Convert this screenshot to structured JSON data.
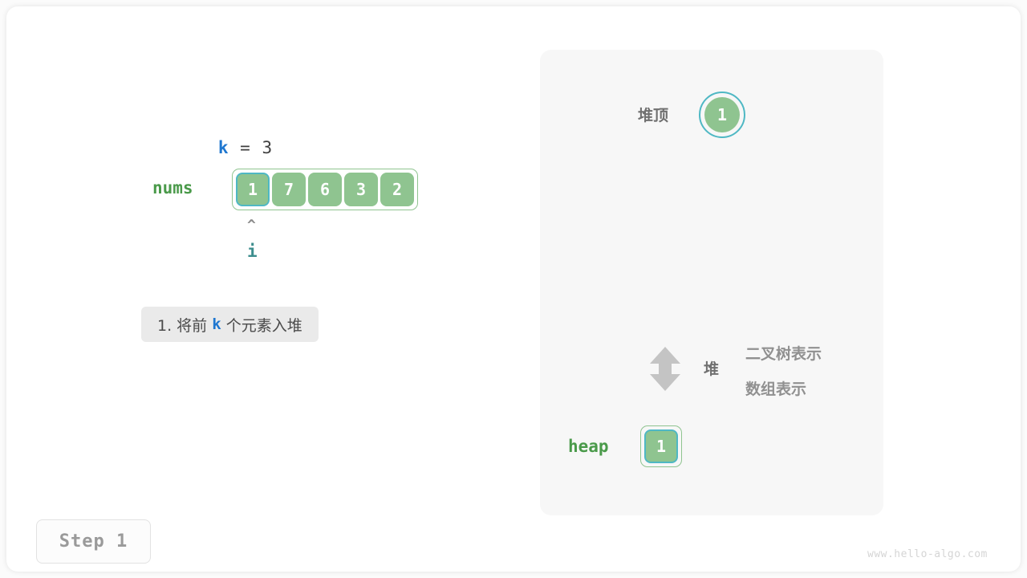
{
  "left": {
    "k_label": "k",
    "k_rest": " = 3",
    "nums_label": "nums",
    "nums_values": [
      "1",
      "7",
      "6",
      "3",
      "2"
    ],
    "nums_highlight_index": 0,
    "pointer_caret": "^",
    "pointer_name": "i",
    "caption_prefix": "1. 将前 ",
    "caption_keyword": "k",
    "caption_suffix": " 个元素入堆"
  },
  "right": {
    "heap_top_label": "堆顶",
    "heap_top_value": "1",
    "relation_label": "堆",
    "repr_binary_tree": "二叉树表示",
    "repr_array": "数组表示",
    "heap_label": "heap",
    "heap_values": [
      "1"
    ],
    "heap_highlight_index": 0
  },
  "footer": {
    "step_label": "Step 1",
    "watermark": "www.hello-algo.com"
  },
  "colors": {
    "cell_fill": "#8fc490",
    "cell_highlight_border": "#4fb8c4",
    "container_border": "#8fc490",
    "var_blue": "#1f77d0",
    "var_green": "#4a9a4a",
    "pointer_teal": "#3d8e8e",
    "panel_bg": "#f7f7f7",
    "caption_bg": "#eaeaea",
    "arrow_gray": "#c4c4c4"
  }
}
